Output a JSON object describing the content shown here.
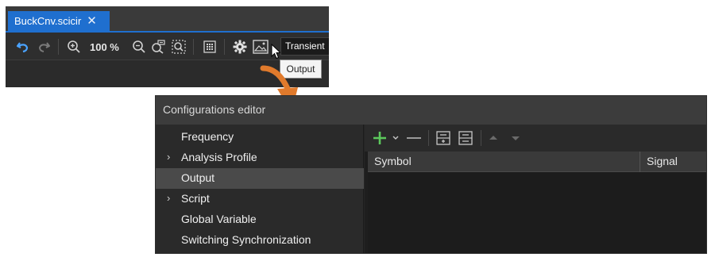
{
  "document_tab": {
    "title": "BuckCnv.scicir",
    "close_glyph": "✕"
  },
  "toolbar": {
    "zoom_level": "100 %",
    "analysis_mode": "Transient",
    "icons": [
      "undo-icon",
      "redo-icon",
      "zoom-in-icon",
      "zoom-out-icon",
      "zoom-fit-icon",
      "zoom-select-icon",
      "grid-icon",
      "settings-icon",
      "output-icon",
      "cursor-icon"
    ]
  },
  "tooltip": {
    "text": "Output"
  },
  "config_editor": {
    "title": "Configurations editor",
    "tree_items": [
      {
        "label": "Frequency",
        "expandable": false,
        "selected": false
      },
      {
        "label": "Analysis Profile",
        "expandable": true,
        "selected": false
      },
      {
        "label": "Output",
        "expandable": false,
        "selected": true
      },
      {
        "label": "Script",
        "expandable": true,
        "selected": false
      },
      {
        "label": "Global Variable",
        "expandable": false,
        "selected": false
      },
      {
        "label": "Switching Synchronization",
        "expandable": false,
        "selected": false
      }
    ],
    "expand_glyph": "›",
    "grid_toolbar_icons": [
      "add-icon",
      "dropdown-icon",
      "remove-icon",
      "expand-all-icon",
      "collapse-all-icon",
      "move-up-icon",
      "move-down-icon"
    ],
    "columns": [
      "Symbol",
      "Signal"
    ]
  },
  "colors": {
    "accent_blue": "#1f6fcf",
    "arrow_orange": "#e07a2c",
    "add_green": "#5cc85c",
    "panel_dark": "#2b2b2b"
  }
}
